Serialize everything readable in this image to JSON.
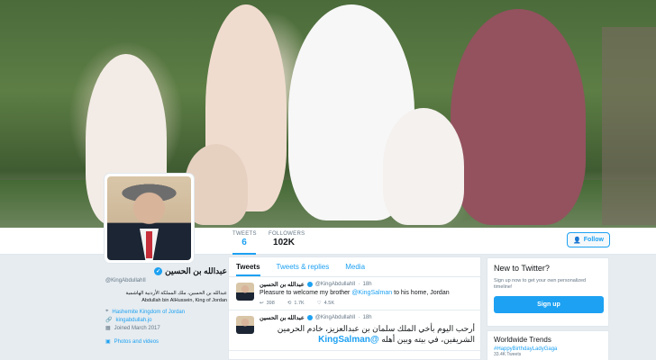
{
  "header": {
    "stats": [
      {
        "label": "TWEETS",
        "value": "6"
      },
      {
        "label": "FOLLOWERS",
        "value": "102K"
      }
    ],
    "follow_label": "Follow"
  },
  "profile": {
    "name": "عبدالله بن الحسين",
    "handle": "@KingAbdullahII",
    "bio_ar": "عبدالله بن الحسين، ملك المملكة الأردنية الهاشمية",
    "bio_en": "Abdullah bin AlHussein, King of Jordan",
    "location": "Hashemite Kingdom of Jordan",
    "website": "kingabdullah.jo",
    "joined": "Joined March 2017",
    "photos": "Photos and videos"
  },
  "timeline": {
    "tabs": [
      "Tweets",
      "Tweets & replies",
      "Media"
    ],
    "tweets": [
      {
        "name": "عبدالله بن الحسين",
        "handle": "@KingAbdullahII",
        "time": "18h",
        "text_before": "Pleasure to welcome my brother ",
        "mention": "@KingSalman",
        "text_after": " to his home, Jordan",
        "replies": "398",
        "retweets": "1.7K",
        "likes": "4.5K"
      },
      {
        "name": "عبدالله بن الحسين",
        "handle": "@KingAbdullahII",
        "time": "18h",
        "text_ar": "أرحب اليوم بأخي الملك سلمان بن عبدالعزيز، خادم الحرمين الشريفين، في بيته وبين أهله",
        "mention": "@KingSalman"
      }
    ]
  },
  "sidebar": {
    "new_title": "New to Twitter?",
    "new_text": "Sign up now to get your own personalized timeline!",
    "signup_label": "Sign up",
    "trends_title": "Worldwide Trends",
    "trend_1": "#HappyBirthdayLadyGaga",
    "trend_1_count": "33.4K Tweets"
  },
  "colors": {
    "accent": "#1da1f2",
    "background": "#e6ecf0"
  }
}
